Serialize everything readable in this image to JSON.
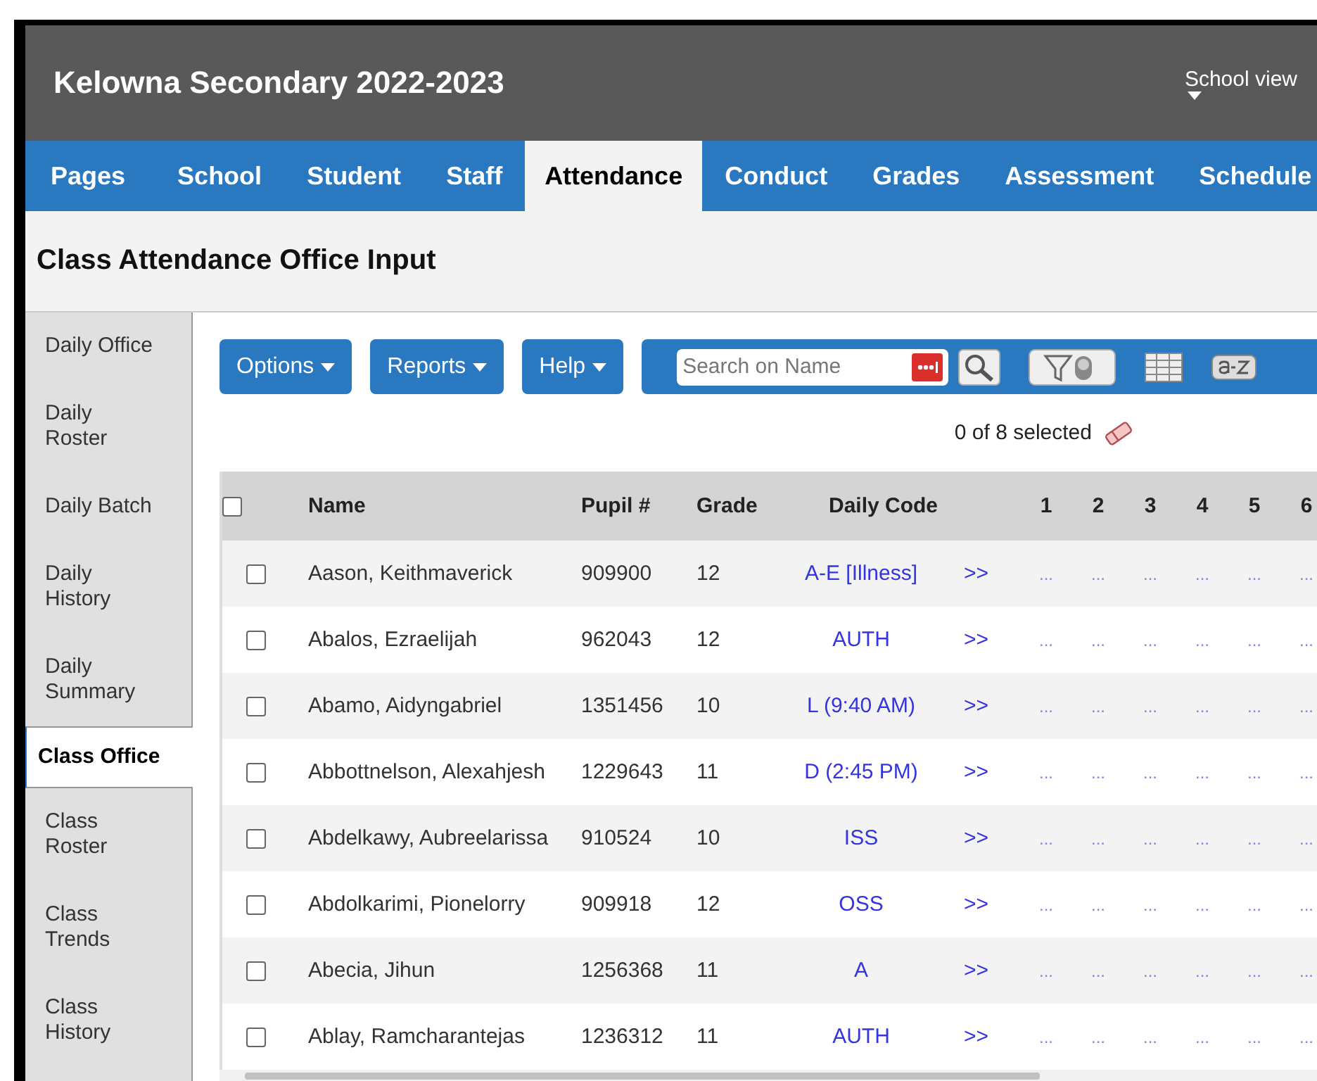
{
  "header": {
    "title": "Kelowna Secondary 2022-2023",
    "view_menu": "School view"
  },
  "tabs": [
    {
      "label": "Pages",
      "selected": false
    },
    {
      "label": "School",
      "selected": false
    },
    {
      "label": "Student",
      "selected": false
    },
    {
      "label": "Staff",
      "selected": false
    },
    {
      "label": "Attendance",
      "selected": true
    },
    {
      "label": "Conduct",
      "selected": false
    },
    {
      "label": "Grades",
      "selected": false
    },
    {
      "label": "Assessment",
      "selected": false
    },
    {
      "label": "Schedule",
      "selected": false
    }
  ],
  "page_title": "Class Attendance Office Input",
  "sidebar": {
    "items": [
      {
        "label": "Daily Office",
        "selected": false
      },
      {
        "label": "Daily\nRoster",
        "selected": false
      },
      {
        "label": "Daily Batch",
        "selected": false
      },
      {
        "label": "Daily\nHistory",
        "selected": false
      },
      {
        "label": "Daily\nSummary",
        "selected": false
      },
      {
        "label": "Class Office",
        "selected": true
      },
      {
        "label": "Class\nRoster",
        "selected": false
      },
      {
        "label": "Class\nTrends",
        "selected": false
      },
      {
        "label": "Class\nHistory",
        "selected": false
      }
    ]
  },
  "toolbar": {
    "menus": [
      "Options",
      "Reports",
      "Help"
    ],
    "search": {
      "placeholder": "Search on Name"
    }
  },
  "selection_count": "0 of 8 selected",
  "table": {
    "select_all": {
      "checked": false
    },
    "columns": [
      "Name",
      "Pupil #",
      "Grade",
      "Daily Code",
      "",
      "1",
      "2",
      "3",
      "4",
      "5",
      "6"
    ],
    "rows": [
      {
        "selected": false,
        "name": "Aason, Keithmaverick",
        "pupil": "909900",
        "grade": "12",
        "daily_code": "A-E  [Illness]",
        "detail": ">>",
        "periods": [
          "...",
          "...",
          "...",
          "...",
          "...",
          "..."
        ]
      },
      {
        "selected": false,
        "name": "Abalos, Ezraelijah",
        "pupil": "962043",
        "grade": "12",
        "daily_code": "AUTH",
        "detail": ">>",
        "periods": [
          "...",
          "...",
          "...",
          "...",
          "...",
          "..."
        ]
      },
      {
        "selected": false,
        "name": "Abamo, Aidyngabriel",
        "pupil": "1351456",
        "grade": "10",
        "daily_code": "L (9:40 AM)",
        "detail": ">>",
        "periods": [
          "...",
          "...",
          "...",
          "...",
          "...",
          "..."
        ]
      },
      {
        "selected": false,
        "name": "Abbottnelson, Alexahjesh",
        "pupil": "1229643",
        "grade": "11",
        "daily_code": "D (2:45 PM)",
        "detail": ">>",
        "periods": [
          "...",
          "...",
          "...",
          "...",
          "...",
          "..."
        ]
      },
      {
        "selected": false,
        "name": "Abdelkawy, Aubreelarissa",
        "pupil": "910524",
        "grade": "10",
        "daily_code": "ISS",
        "detail": ">>",
        "periods": [
          "...",
          "...",
          "...",
          "...",
          "...",
          "..."
        ]
      },
      {
        "selected": false,
        "name": "Abdolkarimi, Pionelorry",
        "pupil": "909918",
        "grade": "12",
        "daily_code": "OSS",
        "detail": ">>",
        "periods": [
          "...",
          "...",
          "...",
          "...",
          "...",
          "..."
        ]
      },
      {
        "selected": false,
        "name": "Abecia, Jihun",
        "pupil": "1256368",
        "grade": "11",
        "daily_code": "A",
        "detail": ">>",
        "periods": [
          "...",
          "...",
          "...",
          "...",
          "...",
          "..."
        ]
      },
      {
        "selected": false,
        "name": "Ablay, Ramcharantejas",
        "pupil": "1236312",
        "grade": "11",
        "daily_code": "AUTH",
        "detail": ">>",
        "periods": [
          "...",
          "...",
          "...",
          "...",
          "...",
          "..."
        ]
      }
    ]
  }
}
